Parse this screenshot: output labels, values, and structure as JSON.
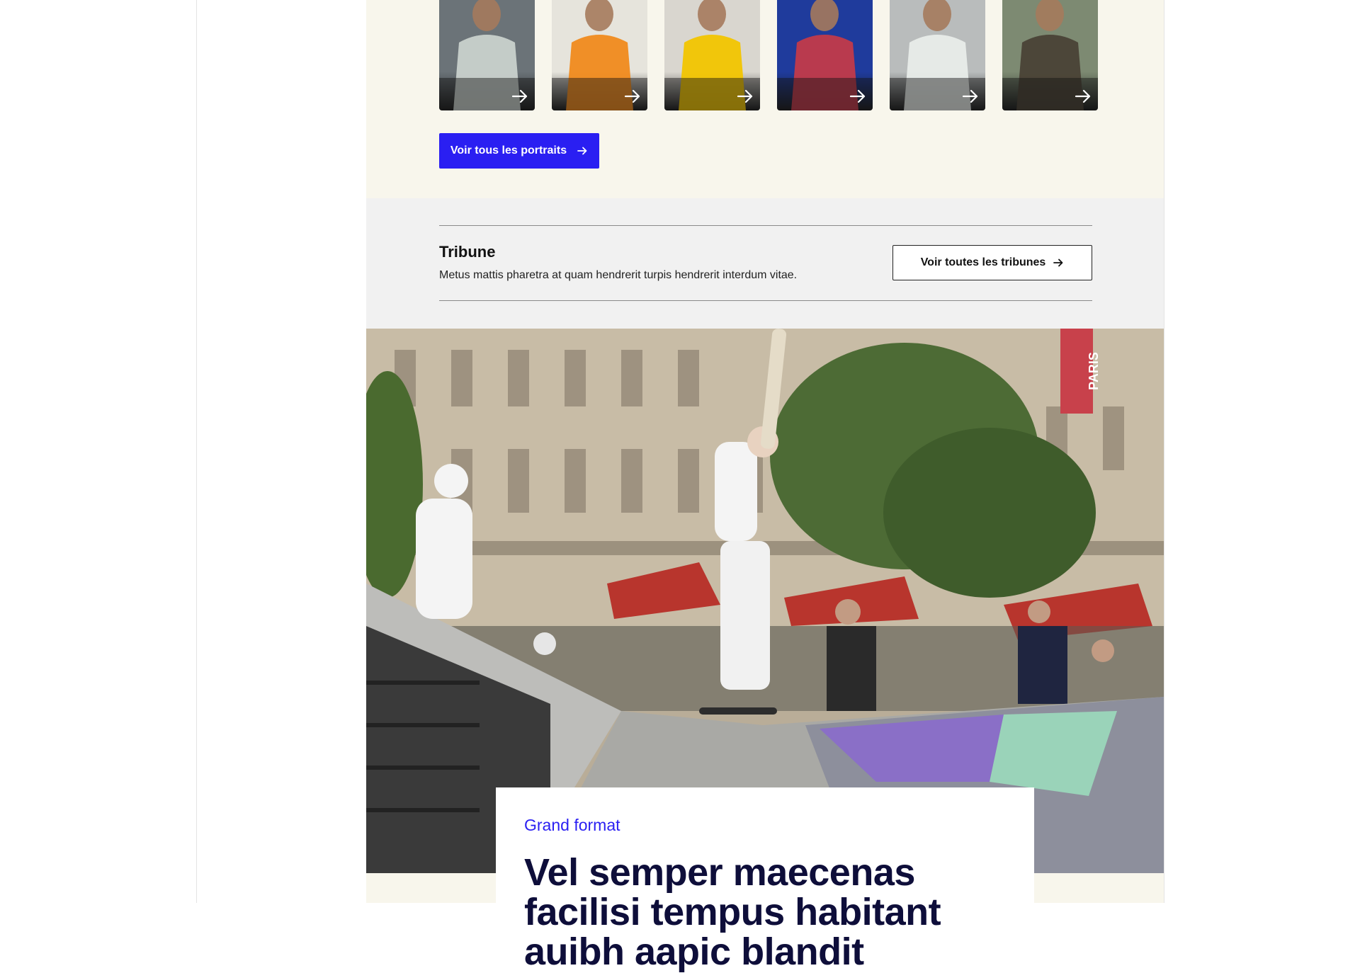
{
  "portraits": {
    "items": [
      {
        "id": "portrait-1",
        "bg": "#6b7378",
        "accent": "#c9d1cc"
      },
      {
        "id": "portrait-2",
        "bg": "#e6e4dc",
        "accent": "#f08a1c"
      },
      {
        "id": "portrait-3",
        "bg": "#d9d6cf",
        "accent": "#f2c500"
      },
      {
        "id": "portrait-4",
        "bg": "#1f3b9c",
        "accent": "#c23a4a"
      },
      {
        "id": "portrait-5",
        "bg": "#b9bcbc",
        "accent": "#e8ece9"
      },
      {
        "id": "portrait-6",
        "bg": "#7d8a72",
        "accent": "#4a4236"
      }
    ],
    "cta_label": "Voir tous les portraits",
    "arrow_icon": "arrow-right-icon"
  },
  "tribune": {
    "title": "Tribune",
    "description": "Metus mattis pharetra at quam hendrerit turpis hendrerit interdum vitae.",
    "cta_label": "Voir toutes les tribunes"
  },
  "hero": {
    "banner_text": "PARIS"
  },
  "feature": {
    "kicker": "Grand format",
    "title": "Vel semper maecenas facilisi tempus habitant auibh aapic blandit"
  },
  "colors": {
    "accent": "#2a1ff2",
    "cream": "#f8f6ec",
    "grey_band": "#f1f1f1",
    "title_navy": "#0e0e3a"
  }
}
